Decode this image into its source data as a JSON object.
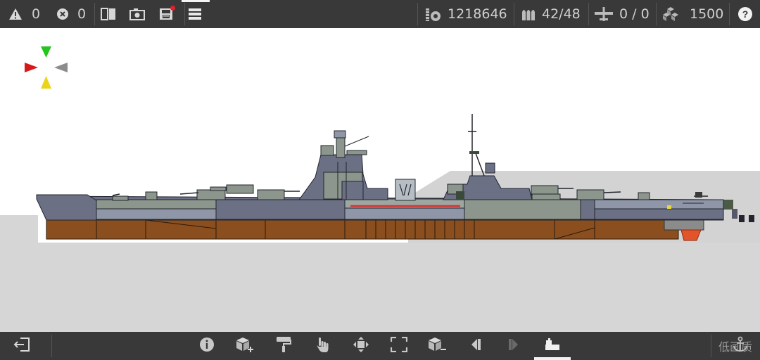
{
  "topbar": {
    "warnings": {
      "icon": "warning-icon",
      "count": "0"
    },
    "errors": {
      "icon": "error-icon",
      "count": "0"
    },
    "tools": [
      "mirror-icon",
      "camera-icon",
      "save-icon",
      "menu-icon"
    ],
    "stats": {
      "cost": {
        "icon": "coins-icon",
        "value": "1218646"
      },
      "ammo": {
        "icon": "ammo-icon",
        "value": "42/48"
      },
      "aircraft": {
        "icon": "aircraft-icon",
        "value": "0 / 0"
      },
      "parts": {
        "icon": "cubes-icon",
        "value": "1500"
      }
    },
    "help_icon": "help-icon"
  },
  "bottombar": {
    "exit_icon": "exit-icon",
    "tools": [
      "info-icon",
      "add-part-icon",
      "paint-roller-icon",
      "hand-icon",
      "move-icon",
      "resize-icon",
      "remove-part-icon",
      "step-back-icon",
      "step-forward-icon",
      "ship-view-icon"
    ],
    "quality_label": "低画质",
    "anchor_icon": "anchor-icon"
  },
  "colors": {
    "bar_bg": "#393939",
    "hull_bottom": "#8b4f1f",
    "hull_side": "#6b7085",
    "deck_green": "#8c968c",
    "waterline_red": "#d93030",
    "ground": "#d6d6d6"
  }
}
